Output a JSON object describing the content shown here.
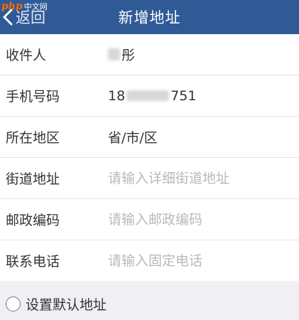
{
  "header": {
    "back_label": "返回",
    "title": "新增地址",
    "back_icon": "chevron-left-icon"
  },
  "watermark": {
    "logo": "php",
    "text": "中文网"
  },
  "form": {
    "recipient": {
      "label": "收件人",
      "value": "彤"
    },
    "phone": {
      "label": "手机号码",
      "value_prefix": "18",
      "value_suffix": "751"
    },
    "region": {
      "label": "所在地区",
      "value": "省/市/区"
    },
    "street": {
      "label": "街道地址",
      "placeholder": "请输入详细街道地址",
      "value": ""
    },
    "postal": {
      "label": "邮政编码",
      "placeholder": "请输入邮政编码",
      "value": ""
    },
    "landline": {
      "label": "联系电话",
      "placeholder": "请输入固定电话",
      "value": ""
    }
  },
  "default_address": {
    "label": "设置默认地址",
    "checked": false
  },
  "colors": {
    "nav_bar": "#2f5a96",
    "page_bg": "#efeff4",
    "placeholder": "#b9b9bd"
  }
}
